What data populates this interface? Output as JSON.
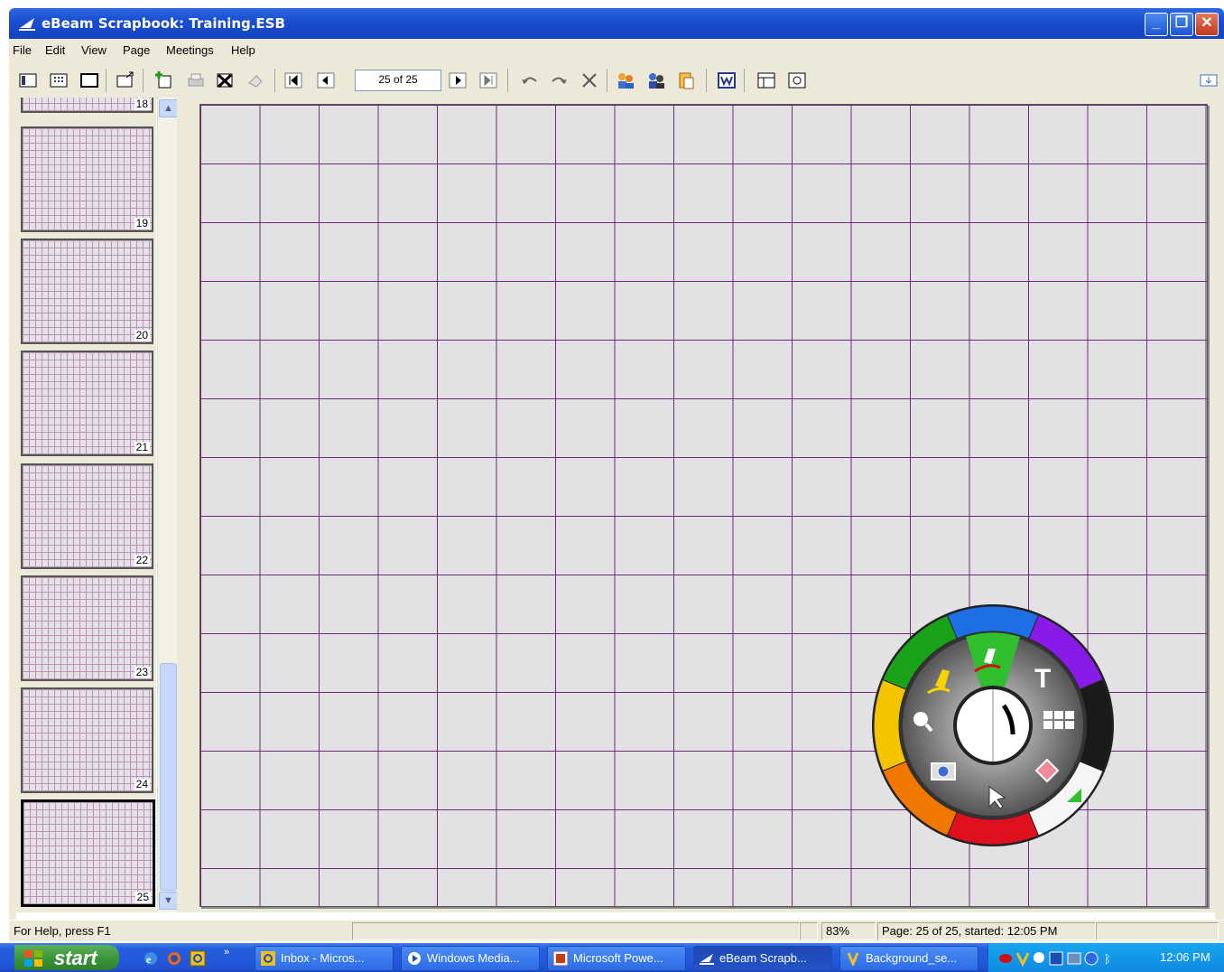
{
  "window": {
    "title": "eBeam Scrapbook: Training.ESB",
    "controls": [
      "minimize",
      "restore",
      "close"
    ]
  },
  "menu": [
    "File",
    "Edit",
    "View",
    "Page",
    "Meetings",
    "Help"
  ],
  "toolbar": {
    "page_field": "25 of 25"
  },
  "thumbnails": {
    "pages": [
      "18",
      "19",
      "20",
      "21",
      "22",
      "23",
      "24",
      "25"
    ],
    "selected": "25"
  },
  "palette": {
    "colors": [
      "#1e6fe6",
      "#8a1ae8",
      "#1a1a1a",
      "#f5f5f5",
      "#e01020",
      "#f07800",
      "#f5c400",
      "#1aa21a"
    ],
    "tools": [
      "pen",
      "text",
      "stamp",
      "eraser",
      "pointer",
      "camera",
      "magnifier",
      "highlighter"
    ],
    "active_tool": "pen"
  },
  "statusbar": {
    "help": "For Help, press F1",
    "zoom": "83%",
    "page_info": "Page: 25 of 25, started: 12:05 PM"
  },
  "taskbar": {
    "start": "start",
    "tasks": [
      {
        "label": "Inbox - Micros...",
        "icon": "outlook-icon",
        "active": false
      },
      {
        "label": "Windows Media...",
        "icon": "media-player-icon",
        "active": false
      },
      {
        "label": "Microsoft Powe...",
        "icon": "powerpoint-icon",
        "active": false
      },
      {
        "label": "eBeam Scrapb...",
        "icon": "ebeam-icon",
        "active": true
      },
      {
        "label": "Background_se...",
        "icon": "background-icon",
        "active": false
      }
    ],
    "clock": "12:06 PM"
  }
}
